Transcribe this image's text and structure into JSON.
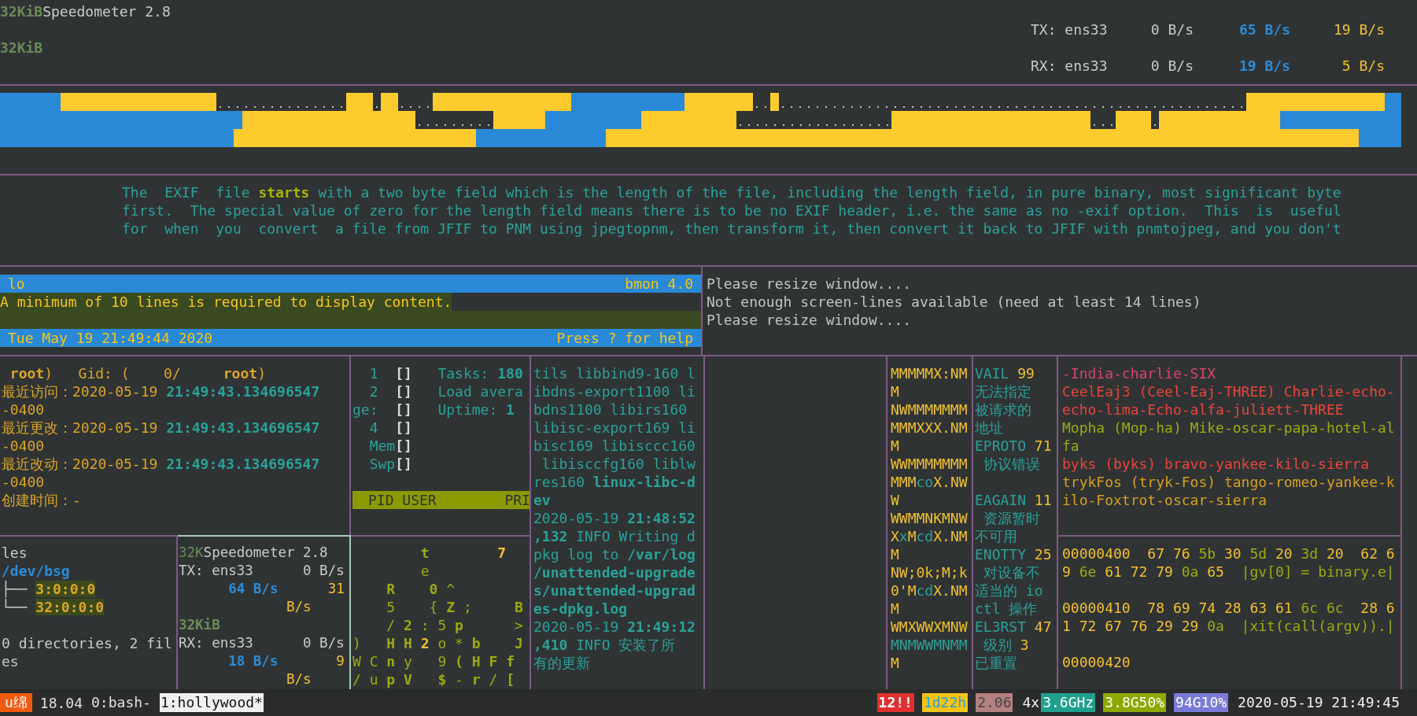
{
  "top_meter": {
    "title_dim": "32KiB",
    "title": "Speedometer 2.8",
    "dim_label": "32KiB",
    "rows": [
      {
        "label": "TX: ens33",
        "value_1": "0 B/s",
        "value_2": "65 B/s",
        "value_3": "19 B/s"
      },
      {
        "label": "RX: ens33",
        "value_1": "0 B/s",
        "value_2": "19 B/s",
        "value_3": "5 B/s"
      }
    ]
  },
  "man_page": {
    "lines": [
      [
        {
          "text": "The  EXIF  file "
        },
        {
          "text": "**starts**",
          "color": "#a8b400"
        },
        {
          "text": " with a two byte field which is the length of the file, including the length field, in pure binary, most significant byte"
        }
      ],
      "first.  The special value of zero for the length field means there is to be no EXIF header, i.e. the same as no -exif option.  This  is  useful",
      "for  when  you  convert  a file from JFIF to PNM using jpegtopnm, then transform it, then convert it back to JFIF with pnmtojpeg, and you don't"
    ]
  },
  "bmon": {
    "interface": "lo",
    "version": "bmon 4.0",
    "message": "A minimum of 10 lines is required to display content.",
    "clock": "Tue May 19 21:49:44 2020",
    "help": "Press ? for help"
  },
  "resize_notice": {
    "lines": [
      "Please resize window....",
      "Not enough screen-lines available (need at least 14 lines)",
      "Please resize window...."
    ]
  },
  "stat_pane": {
    "lines": [
      " **root**)   Gid: (    0/     **root**)",
      [
        {
          "text": "最近访问：2020-05-19 "
        },
        {
          "text": "**21:49:43.134696547**",
          "color": "#2aa198"
        }
      ],
      "-0400",
      [
        {
          "text": "最近更改：2020-05-19 "
        },
        {
          "text": "**21:49:43.134696547**",
          "color": "#2aa198"
        }
      ],
      "-0400",
      [
        {
          "text": "最近改动：2020-05-19 "
        },
        {
          "text": "**21:49:43.134696547**",
          "color": "#2aa198"
        }
      ],
      "-0400",
      "创建时间：-"
    ]
  },
  "htop_pane": {
    "header": "PID USER        PRI",
    "lines": [
      [
        {
          "text": "  1  "
        },
        {
          "text": "**[]**",
          "color": "#d8d8d8"
        },
        {
          "text": "   Tasks: **180**"
        }
      ],
      [
        {
          "text": "  2  "
        },
        {
          "text": "**[]**",
          "color": "#d8d8d8"
        },
        {
          "text": "   Load avera"
        }
      ],
      [
        {
          "text": "ge:  "
        },
        {
          "text": "**[]**",
          "color": "#d8d8d8"
        },
        {
          "text": "   Uptime: **1**"
        }
      ],
      [
        {
          "text": "  4  "
        },
        {
          "text": "**[]**",
          "color": "#d8d8d8"
        }
      ],
      [
        {
          "text": "  Mem"
        },
        {
          "text": "**[]**",
          "color": "#d8d8d8"
        }
      ],
      [
        {
          "text": "  Swp"
        },
        {
          "text": "**[]**",
          "color": "#d8d8d8"
        }
      ]
    ]
  },
  "log_pane": {
    "lines": [
      "tils libbind9-160 l",
      "ibdns-export1100 li",
      "bdns1100 libirs160",
      "libisc-export169 li",
      "bisc169 libisccc160",
      " libisccfg160 liblw",
      "res160 **linux-libc-d**",
      "**ev**",
      "2020-05-19 **21:48:52**",
      "**,132** INFO Writing d",
      "pkg log to **/var/log**",
      "**/unattended-upgrade**",
      "**s/unattended-upgrad**",
      "**es-dpkg.log**",
      "2020-05-19 **21:49:12**",
      "**,410** INFO 安装了所",
      "有的更新"
    ]
  },
  "matrix_pane": {
    "lines": [
      "MMMMMX:NM",
      "M",
      "NWMMMMMMM",
      "MMMXXX.NM",
      "M",
      "WWMMMMMMM",
      [
        {
          "text": "MMM"
        },
        {
          "text": "co",
          "color": "#2aa198"
        },
        {
          "text": "X.NW"
        }
      ],
      "W",
      "WWMMNKMNW",
      [
        {
          "text": "X"
        },
        {
          "text": "x",
          "color": "#2aa198"
        },
        {
          "text": "M"
        },
        {
          "text": "cd",
          "color": "#2aa198"
        },
        {
          "text": "X.NM"
        }
      ],
      "M",
      "NW;0k;M;k",
      [
        {
          "text": "0'M"
        },
        {
          "text": "cd",
          "color": "#2aa198"
        },
        {
          "text": "X.NM"
        }
      ],
      "M",
      "WMXWWXMNW",
      [
        {
          "text": "MNMWWMNMM",
          "color": "#2aa198"
        }
      ],
      "M"
    ]
  },
  "errno_pane": {
    "lines": [
      [
        {
          "text": "VAIL "
        },
        {
          "text": "99",
          "color": "#f0c030"
        }
      ],
      "无法指定",
      "被请求的",
      "地址",
      [
        {
          "text": "EPROTO "
        },
        {
          "text": "71",
          "color": "#f0c030"
        }
      ],
      " 协议错误",
      {
        "kind": "gap"
      },
      [
        {
          "text": "EAGAIN "
        },
        {
          "text": "11",
          "color": "#f0c030"
        }
      ],
      " 资源暂时",
      "不可用",
      [
        {
          "text": "ENOTTY "
        },
        {
          "text": "25",
          "color": "#f0c030"
        }
      ],
      " 对设备不",
      "适当的 io",
      "ctl 操作",
      [
        {
          "text": "EL3RST "
        },
        {
          "text": "47",
          "color": "#f0c030"
        }
      ],
      [
        {
          "text": " 级别 "
        },
        {
          "text": "3",
          "color": "#f0c030"
        }
      ],
      "已重置"
    ]
  },
  "callsign_pane": {
    "lines": [
      [
        {
          "text": "-India-charlie-SIX",
          "color": "#d8456a"
        }
      ],
      [
        {
          "text": "CeelEaj3 (Ceel-Eaj-THREE) Charlie-echo-",
          "color": "#e8453c"
        }
      ],
      [
        {
          "text": "echo-lima-Echo-alfa-juliett-THREE",
          "color": "#e8453c"
        }
      ],
      [
        {
          "text": "Mopha (Mop-ha) Mike-oscar-papa-hotel-al",
          "color": "#9aaa10"
        }
      ],
      [
        {
          "text": "fa",
          "color": "#9aaa10"
        }
      ],
      [
        {
          "text": "byks (byks) bravo-yankee-kilo-sierra",
          "color": "#e8453c"
        }
      ],
      [
        {
          "text": "trykFos (tryk-Fos) tango-romeo-yankee-k",
          "color": "#d4a020"
        }
      ],
      [
        {
          "text": "ilo-Foxtrot-oscar-sierra",
          "color": "#d4a020"
        }
      ]
    ]
  },
  "hexdump_pane": {
    "lines": [
      [
        {
          "text": "00000400  67 76 "
        },
        {
          "text": "5b",
          "color": "#9aaa10"
        },
        {
          "text": " 30 "
        },
        {
          "text": "5d",
          "color": "#9aaa10"
        },
        {
          "text": " 20 "
        },
        {
          "text": "3d",
          "color": "#9aaa10"
        },
        {
          "text": " 20  62 6"
        }
      ],
      [
        {
          "text": "9 "
        },
        {
          "text": "6e",
          "color": "#9aaa10"
        },
        {
          "text": " 61 72 79 "
        },
        {
          "text": "0a",
          "color": "#9aaa10"
        },
        {
          "text": " 65"
        },
        {
          "text": "  |gv[0] = binary.e|",
          "color": "#9aaa10"
        }
      ],
      {
        "kind": "gap"
      },
      [
        {
          "text": "00000410  78 69 74 28 63 61 "
        },
        {
          "text": "6c 6c",
          "color": "#9aaa10"
        },
        {
          "text": "  28 6"
        }
      ],
      [
        {
          "text": "1 72 67 76 29 29 "
        },
        {
          "text": "0a",
          "color": "#9aaa10"
        },
        {
          "text": "  |xit(call(argv)).|",
          "color": "#9aaa10"
        }
      ],
      {
        "kind": "gap"
      },
      "00000420"
    ]
  },
  "tree_pane": {
    "lines": [
      "les",
      [
        {
          "text": "**/dev/bsg**",
          "color": "#2b8bd6"
        }
      ],
      [
        {
          "text": "├── "
        },
        {
          "text": "**3:0:0:0**",
          "color": "#d9a52a",
          "kind": "highlight"
        }
      ],
      [
        {
          "text": "└── "
        },
        {
          "text": "**32:0:0:0**",
          "color": "#d9a52a",
          "kind": "highlight"
        }
      ],
      {
        "kind": "gap"
      },
      "0 directories, 2 fil",
      "es"
    ]
  },
  "mini_meter": {
    "lines": [
      [
        {
          "text": "32K",
          "color": "#6a8a58"
        },
        {
          "text": "Speedometer 2.8"
        }
      ],
      "TX: ens33      0 B/s",
      [
        {
          "text": "      **64 B/s**",
          "color": "#2b8bd6"
        },
        {
          "text": "      31",
          "color": "#f0c030"
        }
      ],
      [
        {
          "text": "             B/s",
          "color": "#f0c030"
        }
      ],
      [
        {
          "text": "**32KiB**",
          "color": "#6a8a58"
        }
      ],
      "RX: ens33      0 B/s",
      [
        {
          "text": "      **18 B/s**",
          "color": "#2b8bd6"
        },
        {
          "text": "       9",
          "color": "#f0c030"
        }
      ],
      [
        {
          "text": "             B/s",
          "color": "#f0c030"
        }
      ]
    ]
  },
  "glyph_pane": {
    "lines": [
      [
        {
          "text": "        **t**"
        },
        {
          "text": "        **7**",
          "color": "#f0c030"
        }
      ],
      "        e",
      "    **R**    **0** ^",
      "    5    { **Z** ;     **B**",
      "    / **2** : 5 **p**      >",
      [
        {
          "text": ")   **H H**"
        },
        {
          "text": " **2**",
          "color": "#f0c030"
        },
        {
          "text": " o "
        },
        {
          "text": "*"
        },
        {
          "text": " **b**    **J**"
        }
      ],
      "W C **n** y   9 **(** **H** **F** **f**",
      "/ u **p** **V**   **$** - **r** / **[**"
    ]
  },
  "status_bar": {
    "session": "u绵",
    "version": "18.04",
    "windows": [
      {
        "label": "0:bash-",
        "selected": false
      },
      {
        "label": "1:hollywood*",
        "selected": true
      }
    ],
    "items": [
      {
        "text": "12!!",
        "kind": "alert"
      },
      {
        "text": "1d22h",
        "kind": "uptime"
      },
      {
        "text": "2.06",
        "kind": "load"
      },
      {
        "text": "4x",
        "kind": "plain"
      },
      {
        "text": "3.6GHz",
        "kind": "cpu"
      },
      {
        "text": "3.8G50%",
        "kind": "mem"
      },
      {
        "text": "94G10%",
        "kind": "disk"
      },
      {
        "text": "2020-05-19 21:49:45",
        "kind": "plain"
      }
    ]
  }
}
